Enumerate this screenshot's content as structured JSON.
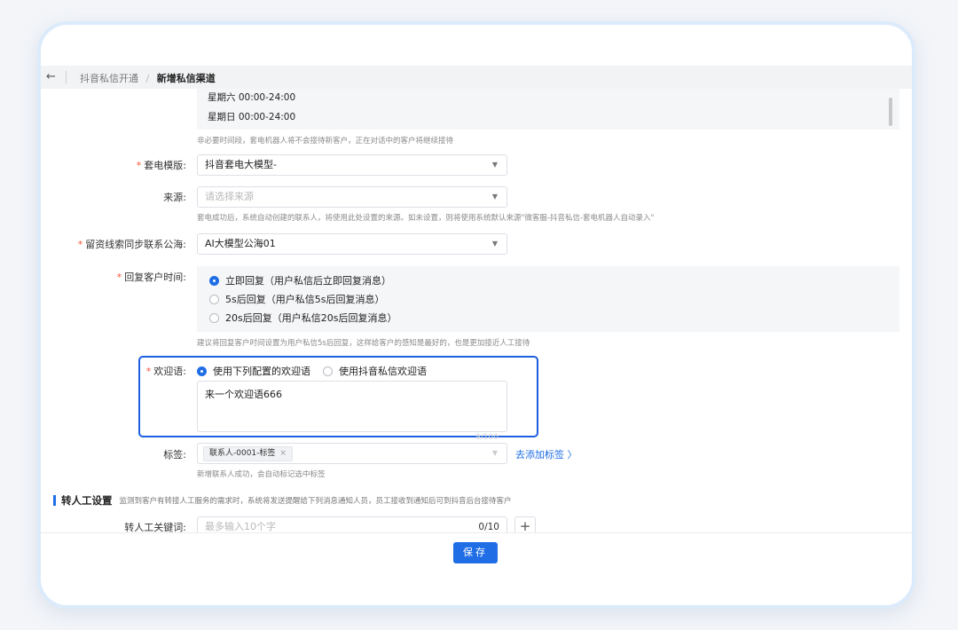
{
  "breadcrumb": {
    "parent": "抖音私信开通",
    "separator": "/",
    "current": "新增私信渠道"
  },
  "hours": {
    "lines": [
      "星期六  00:00-24:00",
      "星期日  00:00-24:00"
    ],
    "hint": "非必要时间段，套电机器人将不会接待新客户，正在对话中的客户将继续接待"
  },
  "form": {
    "template": {
      "label": "套电模版:",
      "value": "抖音套电大模型-"
    },
    "source": {
      "label": "来源:",
      "placeholder": "请选择来源",
      "hint": "套电成功后，系统自动创建的联系人，将使用此处设置的来源。如未设置，则将使用系统默认来源\"微客服-抖音私信-套电机器人自动录入\""
    },
    "pool": {
      "label": "留资线索同步联系公海:",
      "value": "AI大模型公海01"
    },
    "reply_time": {
      "label": "回复客户时间:",
      "options": [
        "立即回复（用户私信后立即回复消息）",
        "5s后回复（用户私信5s后回复消息）",
        "20s后回复（用户私信20s后回复消息）"
      ],
      "selected_index": 0,
      "hint": "建议将回复客户时间设置为用户私信5s后回复，这样给客户的感知是最好的，也是更加接近人工接待"
    },
    "welcome": {
      "label": "欢迎语:",
      "options": [
        "使用下列配置的欢迎语",
        "使用抖音私信欢迎语"
      ],
      "selected_index": 0,
      "text": "来一个欢迎语666",
      "counter": "9/100"
    },
    "tags": {
      "label": "标签:",
      "chip": "联系人-0001-标签",
      "chip_close": "×",
      "add_link": "去添加标签 〉",
      "hint": "新增联系人成功，会自动标记选中标签"
    }
  },
  "transfer": {
    "title": "转人工设置",
    "desc": "监测到客户有转接人工服务的需求时，系统将发送提醒给下列消息通知人员，员工接收到通知后可到抖音后台接待客户",
    "keyword_label": "转人工关键词:",
    "keyword_placeholder": "最多输入10个字",
    "keyword_count": "0/10",
    "add_symbol": "+"
  },
  "footer": {
    "save_label": "保存"
  },
  "icons": {
    "back": "back-arrow-icon",
    "caret": "caret-down-icon",
    "add": "plus-icon"
  },
  "colors": {
    "accent": "#1f6ee6",
    "required": "#f5543a",
    "highlight_border": "#1d5fe0"
  }
}
